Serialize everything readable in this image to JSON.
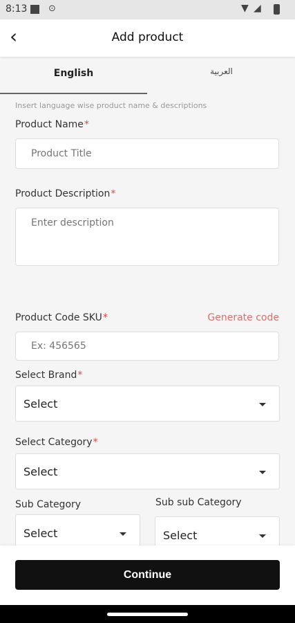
{
  "status_bar": {
    "time": "8:13",
    "icons": [
      "square-icon",
      "location-icon",
      "wifi-icon",
      "signal-icon",
      "battery-icon"
    ]
  },
  "header": {
    "title": "Add product",
    "back_icon": "back-arrow-icon"
  },
  "tabs": [
    {
      "label": "English",
      "active": true
    },
    {
      "label": "العربية",
      "active": false
    }
  ],
  "hint": "Insert language wise product name & descriptions",
  "product_name": {
    "label": "Product Name",
    "required_mark": "*",
    "placeholder": "Product Title"
  },
  "product_description": {
    "label": "Product Description",
    "required_mark": "*",
    "placeholder": "Enter description"
  },
  "sku": {
    "label": "Product Code SKU",
    "required_mark": "*",
    "placeholder": "Ex: 456565",
    "generate_label": "Generate code"
  },
  "brand": {
    "label": "Select Brand",
    "required_mark": "*",
    "value": "Select"
  },
  "category": {
    "label": "Select Category",
    "required_mark": "*",
    "value": "Select"
  },
  "sub_category": {
    "label": "Sub Category",
    "value": "Select"
  },
  "sub_sub_category": {
    "label": "Sub sub Category",
    "value": "Select"
  },
  "footer": {
    "continue_label": "Continue"
  },
  "colors": {
    "accent_red": "#e0473e",
    "primary_button": "#111111",
    "generate_link": "#e26c6c"
  }
}
